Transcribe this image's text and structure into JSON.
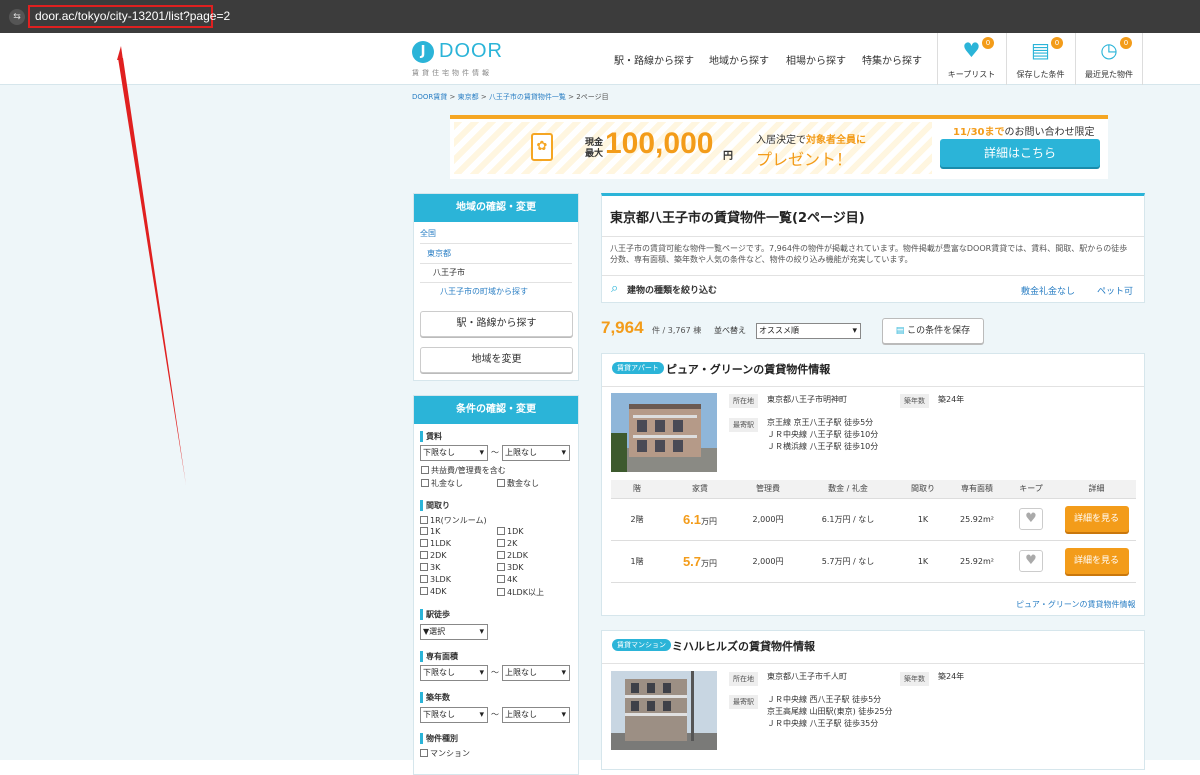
{
  "browser": {
    "url": "door.ac/tokyo/city-13201/list?page=2",
    "site_icon": "tune-icon"
  },
  "header": {
    "logo_mark": "J",
    "logo_text": "DOOR",
    "logo_sub": "賃貸住宅物件情報",
    "nav": [
      "駅・路線から探す",
      "地域から探す",
      "相場から探す",
      "特集から探す"
    ],
    "icons": [
      {
        "label": "キープリスト",
        "badge": "0",
        "icon": "heart-icon"
      },
      {
        "label": "保存した条件",
        "badge": "0",
        "icon": "document-icon"
      },
      {
        "label": "最近見た物件",
        "badge": "0",
        "icon": "clock-icon"
      }
    ]
  },
  "breadcrumb": [
    "DOOR賃貸",
    "東京都",
    "八王子市の賃貸物件一覧",
    "2ページ目"
  ],
  "banner": {
    "cash_label": "現金\n最大",
    "amount": "100,000",
    "yen": "円",
    "line1_a": "入居決定で",
    "line1_b": "対象者全員に",
    "line2": "プレゼント！",
    "right_a": "11/30まで",
    "right_b": "のお問い合わせ限定",
    "button": "詳細はこちら"
  },
  "area": {
    "heading": "地域の確認・変更",
    "levels": [
      "全国",
      "東京都",
      "八王子市",
      "八王子市の町域から探す"
    ],
    "btn_station": "駅・路線から探す",
    "btn_area": "地域を変更"
  },
  "conditions": {
    "heading": "条件の確認・変更",
    "rent_label": "賃料",
    "rent_min": "下限なし",
    "rent_max": "上限なし",
    "tilde": "〜",
    "cb_common": "共益費/管理費を含む",
    "cb_reikin": "礼金なし",
    "cb_shikikin": "敷金なし",
    "layout_label": "間取り",
    "layouts": [
      "1R(ワンルーム)",
      "",
      "1K",
      "1DK",
      "1LDK",
      "2K",
      "2DK",
      "2LDK",
      "3K",
      "3DK",
      "3LDK",
      "4K",
      "4DK",
      "4LDK以上"
    ],
    "walk_label": "駅徒歩",
    "walk_sel": "▼選択",
    "area_label": "専有面積",
    "area_min": "下限なし",
    "area_max": "上限なし",
    "age_label": "築年数",
    "age_min": "下限なし",
    "age_max": "上限なし",
    "type_label": "物件種別",
    "type_first": "マンション"
  },
  "main": {
    "title": "東京都八王子市の賃貸物件一覧(2ページ目)",
    "description": "八王子市の賃貸可能な物件一覧ページです。7,964件の物件が掲載されています。物件掲載が豊富なDOOR賃貸では、賃料、間取、駅からの徒歩分数、専有面積、築年数や人気の条件など、物件の絞り込み機能が充実しています。",
    "narrow": "建物の種類を絞り込む",
    "quick1": "敷金礼金なし",
    "quick2": "ペット可",
    "count": "7,964",
    "count_sub": "件 / 3,767 棟",
    "sort_label": "並べ替え",
    "sort_value": "オススメ順",
    "save": "この条件を保存"
  },
  "table_headers": [
    "階",
    "家賃",
    "管理費",
    "敷金 / 礼金",
    "間取り",
    "専有面積",
    "キープ",
    "詳細"
  ],
  "properties": [
    {
      "badge": "賃貸アパート",
      "name": "ピュア・グリーンの賃貸物件情報",
      "addr_label": "所在地",
      "addr": "東京都八王子市明神町",
      "age_label": "築年数",
      "age": "築24年",
      "station_label": "最寄駅",
      "stations": [
        "京王線 京王八王子駅 徒歩5分",
        "ＪＲ中央線 八王子駅 徒歩10分",
        "ＪＲ横浜線 八王子駅 徒歩10分"
      ],
      "units": [
        {
          "floor": "2階",
          "rent": "6.1",
          "unit": "万円",
          "fee": "2,000円",
          "deposit": "6.1万円 / なし",
          "layout": "1K",
          "area": "25.92m²",
          "detail": "詳細を見る"
        },
        {
          "floor": "1階",
          "rent": "5.7",
          "unit": "万円",
          "fee": "2,000円",
          "deposit": "5.7万円 / なし",
          "layout": "1K",
          "area": "25.92m²",
          "detail": "詳細を見る"
        }
      ],
      "link": "ピュア・グリーンの賃貸物件情報"
    },
    {
      "badge": "賃貸マンション",
      "name": "ミハルヒルズの賃貸物件情報",
      "addr_label": "所在地",
      "addr": "東京都八王子市千人町",
      "age_label": "築年数",
      "age": "築24年",
      "station_label": "最寄駅",
      "stations": [
        "ＪＲ中央線 西八王子駅 徒歩5分",
        "京王高尾線 山田駅(東京) 徒歩25分",
        "ＪＲ中央線 八王子駅 徒歩35分"
      ]
    }
  ],
  "colors": {
    "accent": "#2bb4d8",
    "orange": "#f39c1a",
    "annotation": "#e02020"
  }
}
